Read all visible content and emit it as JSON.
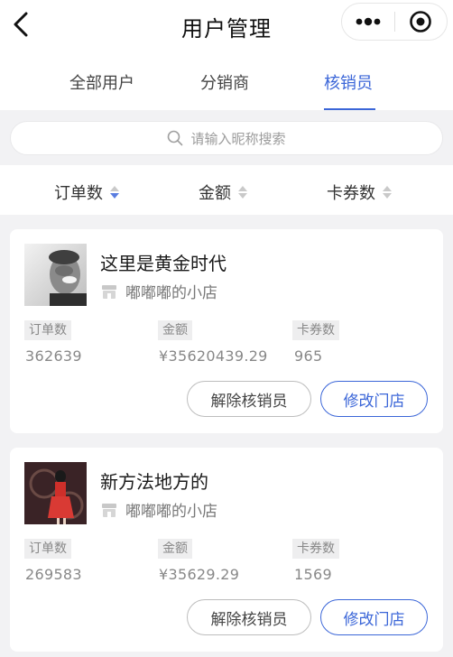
{
  "header": {
    "title": "用户管理"
  },
  "tabs": [
    {
      "label": "全部用户"
    },
    {
      "label": "分销商"
    },
    {
      "label": "核销员",
      "active": true
    }
  ],
  "search": {
    "placeholder": "请输入昵称搜索"
  },
  "sort": [
    {
      "label": "订单数",
      "state": "desc"
    },
    {
      "label": "金额",
      "state": "none"
    },
    {
      "label": "卡券数",
      "state": "none"
    }
  ],
  "colors": {
    "accent": "#3b66d8",
    "background": "#f2f2f4"
  },
  "members": [
    {
      "name": "这里是黄金时代",
      "store": "嘟嘟嘟的小店",
      "labels": {
        "orders": "订单数",
        "amount": "金额",
        "coupons": "卡券数"
      },
      "orders": "362639",
      "amount": "¥35620439.29",
      "coupons": "965",
      "remove_label": "解除核销员",
      "modify_label": "修改门店"
    },
    {
      "name": "新方法地方的",
      "store": "嘟嘟嘟的小店",
      "labels": {
        "orders": "订单数",
        "amount": "金额",
        "coupons": "卡券数"
      },
      "orders": "269583",
      "amount": "¥35629.29",
      "coupons": "1569",
      "remove_label": "解除核销员",
      "modify_label": "修改门店"
    }
  ]
}
